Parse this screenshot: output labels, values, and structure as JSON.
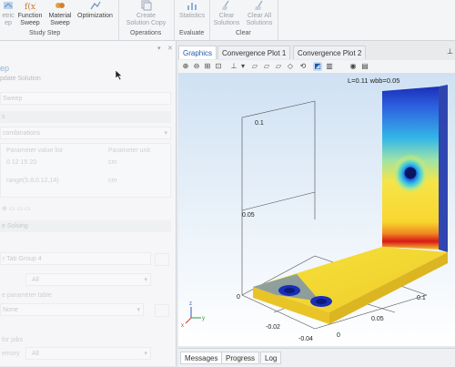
{
  "ribbon": {
    "buttons": [
      {
        "label": "etric\nep"
      },
      {
        "label": "Function\nSweep"
      },
      {
        "label": "Material\nSweep"
      },
      {
        "label": "Optimization"
      },
      {
        "label": "Create\nSolution Copy"
      },
      {
        "label": "Statistics"
      },
      {
        "label": "Clear\nSolutions"
      },
      {
        "label": "Clear All\nSolutions"
      }
    ],
    "groups": [
      "Study Step",
      "Operations",
      "Evaluate",
      "Clear"
    ]
  },
  "left_panel": {
    "title": "ep",
    "subtitle": "pdate Solution",
    "sweep_label": "Sweep",
    "sect1": "s",
    "combo": "combinations",
    "col1": "Parameter value list",
    "col2": "Parameter unit",
    "row1_val": "0 12 15 20",
    "row1_unit": "cm",
    "row2_val": "range(5.8,0.12,14)",
    "row2_unit": "cm",
    "sect2": "e Solving",
    "solver": "r Tab Group 4",
    "all1": "All",
    "tune": "e parameter table",
    "none": "None",
    "jobs": "for jobs",
    "memory": "emory",
    "all2": "All"
  },
  "tabs": [
    "Graphics",
    "Convergence Plot 1",
    "Convergence Plot 2"
  ],
  "plot": {
    "label": "L=0.11  wbb=0.05",
    "axis_ticks_z": [
      "0.1",
      "0.05",
      "0"
    ],
    "axis_ticks_x": [
      "-0.02",
      "-0.04"
    ],
    "axis_ticks_y": [
      "0.1",
      "0.05",
      "0"
    ]
  },
  "bottom_tabs": [
    "Messages",
    "Progress",
    "Log"
  ]
}
